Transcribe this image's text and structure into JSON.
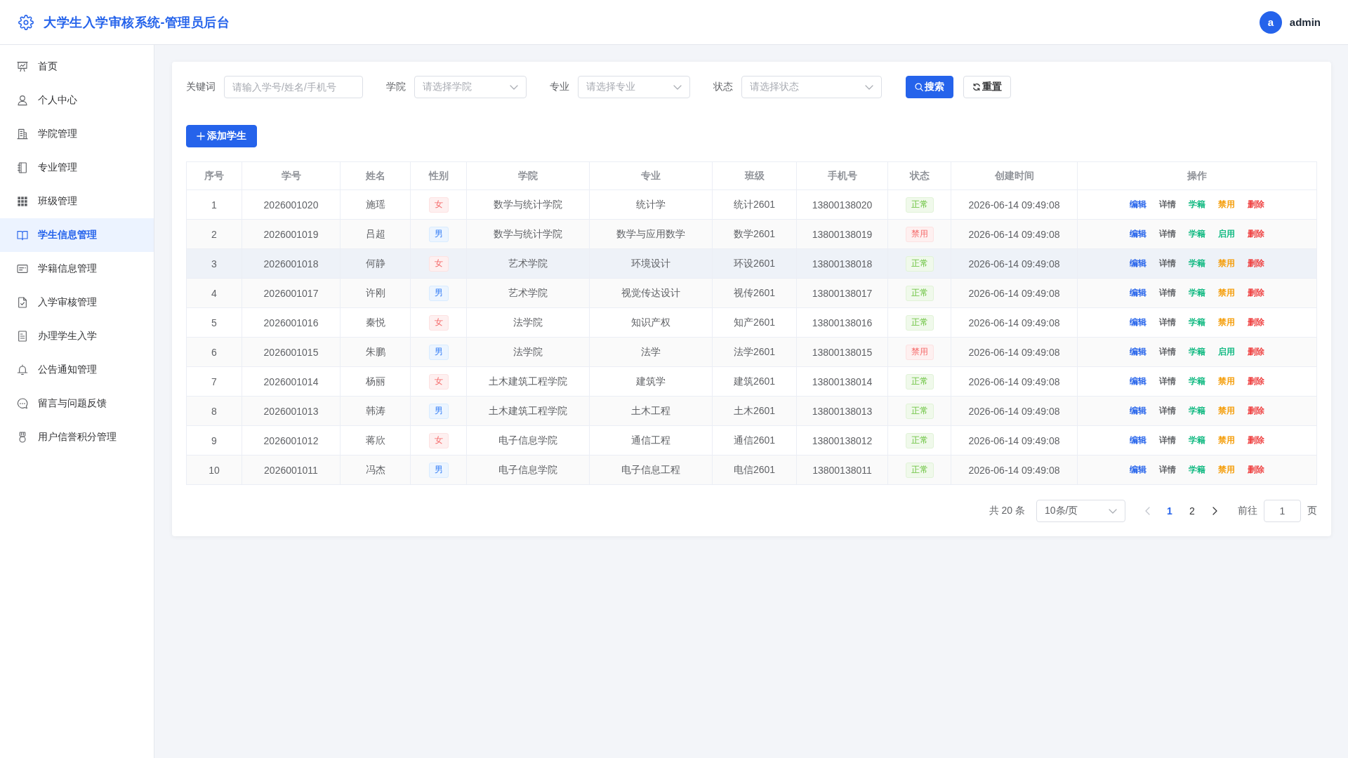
{
  "header": {
    "title": "大学生入学审核系统-管理员后台",
    "user": {
      "avatar_letter": "a",
      "name": "admin"
    }
  },
  "sidebar": {
    "items": [
      {
        "label": "首页",
        "selected": false
      },
      {
        "label": "个人中心",
        "selected": false
      },
      {
        "label": "学院管理",
        "selected": false
      },
      {
        "label": "专业管理",
        "selected": false
      },
      {
        "label": "班级管理",
        "selected": false
      },
      {
        "label": "学生信息管理",
        "selected": true
      },
      {
        "label": "学籍信息管理",
        "selected": false
      },
      {
        "label": "入学审核管理",
        "selected": false
      },
      {
        "label": "办理学生入学",
        "selected": false
      },
      {
        "label": "公告通知管理",
        "selected": false
      },
      {
        "label": "留言与问题反馈",
        "selected": false
      },
      {
        "label": "用户信誉积分管理",
        "selected": false
      }
    ]
  },
  "filters": {
    "fields": [
      {
        "kind": "input",
        "label": "关键词",
        "placeholder": "请输入学号/姓名/手机号"
      },
      {
        "kind": "select",
        "label": "学院",
        "placeholder": "请选择学院"
      },
      {
        "kind": "select",
        "label": "专业",
        "placeholder": "请选择专业"
      },
      {
        "kind": "select",
        "label": "状态",
        "placeholder": "请选择状态"
      }
    ],
    "buttons": [
      {
        "kind": "search",
        "label": "搜索"
      },
      {
        "kind": "reset",
        "label": "重置"
      }
    ]
  },
  "toolbar": {
    "add_button": "添加学生"
  },
  "table": {
    "columns": [
      "序号",
      "学号",
      "姓名",
      "性别",
      "学院",
      "专业",
      "班级",
      "手机号",
      "状态",
      "创建时间",
      "操作"
    ],
    "rows": [
      {
        "no": "1",
        "student_id": "2026001020",
        "name": "施瑶",
        "gender": {
          "text": "女",
          "kind": "female"
        },
        "college": "数学与统计学院",
        "major": "统计学",
        "class": "统计2601",
        "phone": "13800138020",
        "status": {
          "text": "正常",
          "kind": "active"
        },
        "created_at": "2026-06-14 09:49:08",
        "highlighted": false,
        "actions": [
          {
            "label": "编辑",
            "kind": "edit"
          },
          {
            "label": "详情",
            "kind": "detail"
          },
          {
            "label": "学籍",
            "kind": "record"
          },
          {
            "label": "禁用",
            "kind": "disable"
          },
          {
            "label": "删除",
            "kind": "delete"
          }
        ]
      },
      {
        "no": "2",
        "student_id": "2026001019",
        "name": "吕超",
        "gender": {
          "text": "男",
          "kind": "male"
        },
        "college": "数学与统计学院",
        "major": "数学与应用数学",
        "class": "数学2601",
        "phone": "13800138019",
        "status": {
          "text": "禁用",
          "kind": "banned"
        },
        "created_at": "2026-06-14 09:49:08",
        "highlighted": false,
        "actions": [
          {
            "label": "编辑",
            "kind": "edit"
          },
          {
            "label": "详情",
            "kind": "detail"
          },
          {
            "label": "学籍",
            "kind": "record"
          },
          {
            "label": "启用",
            "kind": "enable"
          },
          {
            "label": "删除",
            "kind": "delete"
          }
        ]
      },
      {
        "no": "3",
        "student_id": "2026001018",
        "name": "何静",
        "gender": {
          "text": "女",
          "kind": "female"
        },
        "college": "艺术学院",
        "major": "环境设计",
        "class": "环设2601",
        "phone": "13800138018",
        "status": {
          "text": "正常",
          "kind": "active"
        },
        "created_at": "2026-06-14 09:49:08",
        "highlighted": true,
        "actions": [
          {
            "label": "编辑",
            "kind": "edit"
          },
          {
            "label": "详情",
            "kind": "detail"
          },
          {
            "label": "学籍",
            "kind": "record"
          },
          {
            "label": "禁用",
            "kind": "disable"
          },
          {
            "label": "删除",
            "kind": "delete"
          }
        ]
      },
      {
        "no": "4",
        "student_id": "2026001017",
        "name": "许刚",
        "gender": {
          "text": "男",
          "kind": "male"
        },
        "college": "艺术学院",
        "major": "视觉传达设计",
        "class": "视传2601",
        "phone": "13800138017",
        "status": {
          "text": "正常",
          "kind": "active"
        },
        "created_at": "2026-06-14 09:49:08",
        "highlighted": false,
        "actions": [
          {
            "label": "编辑",
            "kind": "edit"
          },
          {
            "label": "详情",
            "kind": "detail"
          },
          {
            "label": "学籍",
            "kind": "record"
          },
          {
            "label": "禁用",
            "kind": "disable"
          },
          {
            "label": "删除",
            "kind": "delete"
          }
        ]
      },
      {
        "no": "5",
        "student_id": "2026001016",
        "name": "秦悦",
        "gender": {
          "text": "女",
          "kind": "female"
        },
        "college": "法学院",
        "major": "知识产权",
        "class": "知产2601",
        "phone": "13800138016",
        "status": {
          "text": "正常",
          "kind": "active"
        },
        "created_at": "2026-06-14 09:49:08",
        "highlighted": false,
        "actions": [
          {
            "label": "编辑",
            "kind": "edit"
          },
          {
            "label": "详情",
            "kind": "detail"
          },
          {
            "label": "学籍",
            "kind": "record"
          },
          {
            "label": "禁用",
            "kind": "disable"
          },
          {
            "label": "删除",
            "kind": "delete"
          }
        ]
      },
      {
        "no": "6",
        "student_id": "2026001015",
        "name": "朱鹏",
        "gender": {
          "text": "男",
          "kind": "male"
        },
        "college": "法学院",
        "major": "法学",
        "class": "法学2601",
        "phone": "13800138015",
        "status": {
          "text": "禁用",
          "kind": "banned"
        },
        "created_at": "2026-06-14 09:49:08",
        "highlighted": false,
        "actions": [
          {
            "label": "编辑",
            "kind": "edit"
          },
          {
            "label": "详情",
            "kind": "detail"
          },
          {
            "label": "学籍",
            "kind": "record"
          },
          {
            "label": "启用",
            "kind": "enable"
          },
          {
            "label": "删除",
            "kind": "delete"
          }
        ]
      },
      {
        "no": "7",
        "student_id": "2026001014",
        "name": "杨丽",
        "gender": {
          "text": "女",
          "kind": "female"
        },
        "college": "土木建筑工程学院",
        "major": "建筑学",
        "class": "建筑2601",
        "phone": "13800138014",
        "status": {
          "text": "正常",
          "kind": "active"
        },
        "created_at": "2026-06-14 09:49:08",
        "highlighted": false,
        "actions": [
          {
            "label": "编辑",
            "kind": "edit"
          },
          {
            "label": "详情",
            "kind": "detail"
          },
          {
            "label": "学籍",
            "kind": "record"
          },
          {
            "label": "禁用",
            "kind": "disable"
          },
          {
            "label": "删除",
            "kind": "delete"
          }
        ]
      },
      {
        "no": "8",
        "student_id": "2026001013",
        "name": "韩涛",
        "gender": {
          "text": "男",
          "kind": "male"
        },
        "college": "土木建筑工程学院",
        "major": "土木工程",
        "class": "土木2601",
        "phone": "13800138013",
        "status": {
          "text": "正常",
          "kind": "active"
        },
        "created_at": "2026-06-14 09:49:08",
        "highlighted": false,
        "actions": [
          {
            "label": "编辑",
            "kind": "edit"
          },
          {
            "label": "详情",
            "kind": "detail"
          },
          {
            "label": "学籍",
            "kind": "record"
          },
          {
            "label": "禁用",
            "kind": "disable"
          },
          {
            "label": "删除",
            "kind": "delete"
          }
        ]
      },
      {
        "no": "9",
        "student_id": "2026001012",
        "name": "蒋欣",
        "gender": {
          "text": "女",
          "kind": "female"
        },
        "college": "电子信息学院",
        "major": "通信工程",
        "class": "通信2601",
        "phone": "13800138012",
        "status": {
          "text": "正常",
          "kind": "active"
        },
        "created_at": "2026-06-14 09:49:08",
        "highlighted": false,
        "actions": [
          {
            "label": "编辑",
            "kind": "edit"
          },
          {
            "label": "详情",
            "kind": "detail"
          },
          {
            "label": "学籍",
            "kind": "record"
          },
          {
            "label": "禁用",
            "kind": "disable"
          },
          {
            "label": "删除",
            "kind": "delete"
          }
        ]
      },
      {
        "no": "10",
        "student_id": "2026001011",
        "name": "冯杰",
        "gender": {
          "text": "男",
          "kind": "male"
        },
        "college": "电子信息学院",
        "major": "电子信息工程",
        "class": "电信2601",
        "phone": "13800138011",
        "status": {
          "text": "正常",
          "kind": "active"
        },
        "created_at": "2026-06-14 09:49:08",
        "highlighted": false,
        "actions": [
          {
            "label": "编辑",
            "kind": "edit"
          },
          {
            "label": "详情",
            "kind": "detail"
          },
          {
            "label": "学籍",
            "kind": "record"
          },
          {
            "label": "禁用",
            "kind": "disable"
          },
          {
            "label": "删除",
            "kind": "delete"
          }
        ]
      }
    ]
  },
  "pagination": {
    "total": "共 20 条",
    "page_size": "10条/页",
    "prev": {
      "disabled": true
    },
    "pages": [
      {
        "label": "1",
        "selected": true
      },
      {
        "label": "2",
        "selected": false
      }
    ],
    "next": {
      "disabled": false
    },
    "goto_label": "前往",
    "goto_value": "1",
    "page_suffix": "页"
  }
}
